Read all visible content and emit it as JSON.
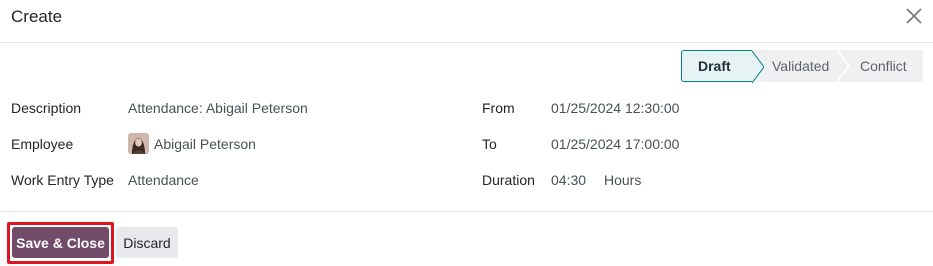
{
  "dialog": {
    "title": "Create"
  },
  "statusbar": {
    "stages": [
      {
        "label": "Draft",
        "active": true
      },
      {
        "label": "Validated",
        "active": false
      },
      {
        "label": "Conflict",
        "active": false
      }
    ]
  },
  "form": {
    "description_label": "Description",
    "description_value": "Attendance: Abigail Peterson",
    "employee_label": "Employee",
    "employee_value": "Abigail Peterson",
    "work_entry_type_label": "Work Entry Type",
    "work_entry_type_value": "Attendance",
    "from_label": "From",
    "from_value": "01/25/2024 12:30:00",
    "to_label": "To",
    "to_value": "01/25/2024 17:00:00",
    "duration_label": "Duration",
    "duration_value": "04:30",
    "duration_unit": "Hours"
  },
  "footer": {
    "save_label": "Save & Close",
    "discard_label": "Discard"
  },
  "icons": {
    "close": "close-icon",
    "avatar": "employee-avatar"
  },
  "colors": {
    "primary": "#714b67",
    "active_stage_border": "#017e84",
    "active_stage_bg": "#e6f2f3",
    "highlight": "#e0141e"
  }
}
